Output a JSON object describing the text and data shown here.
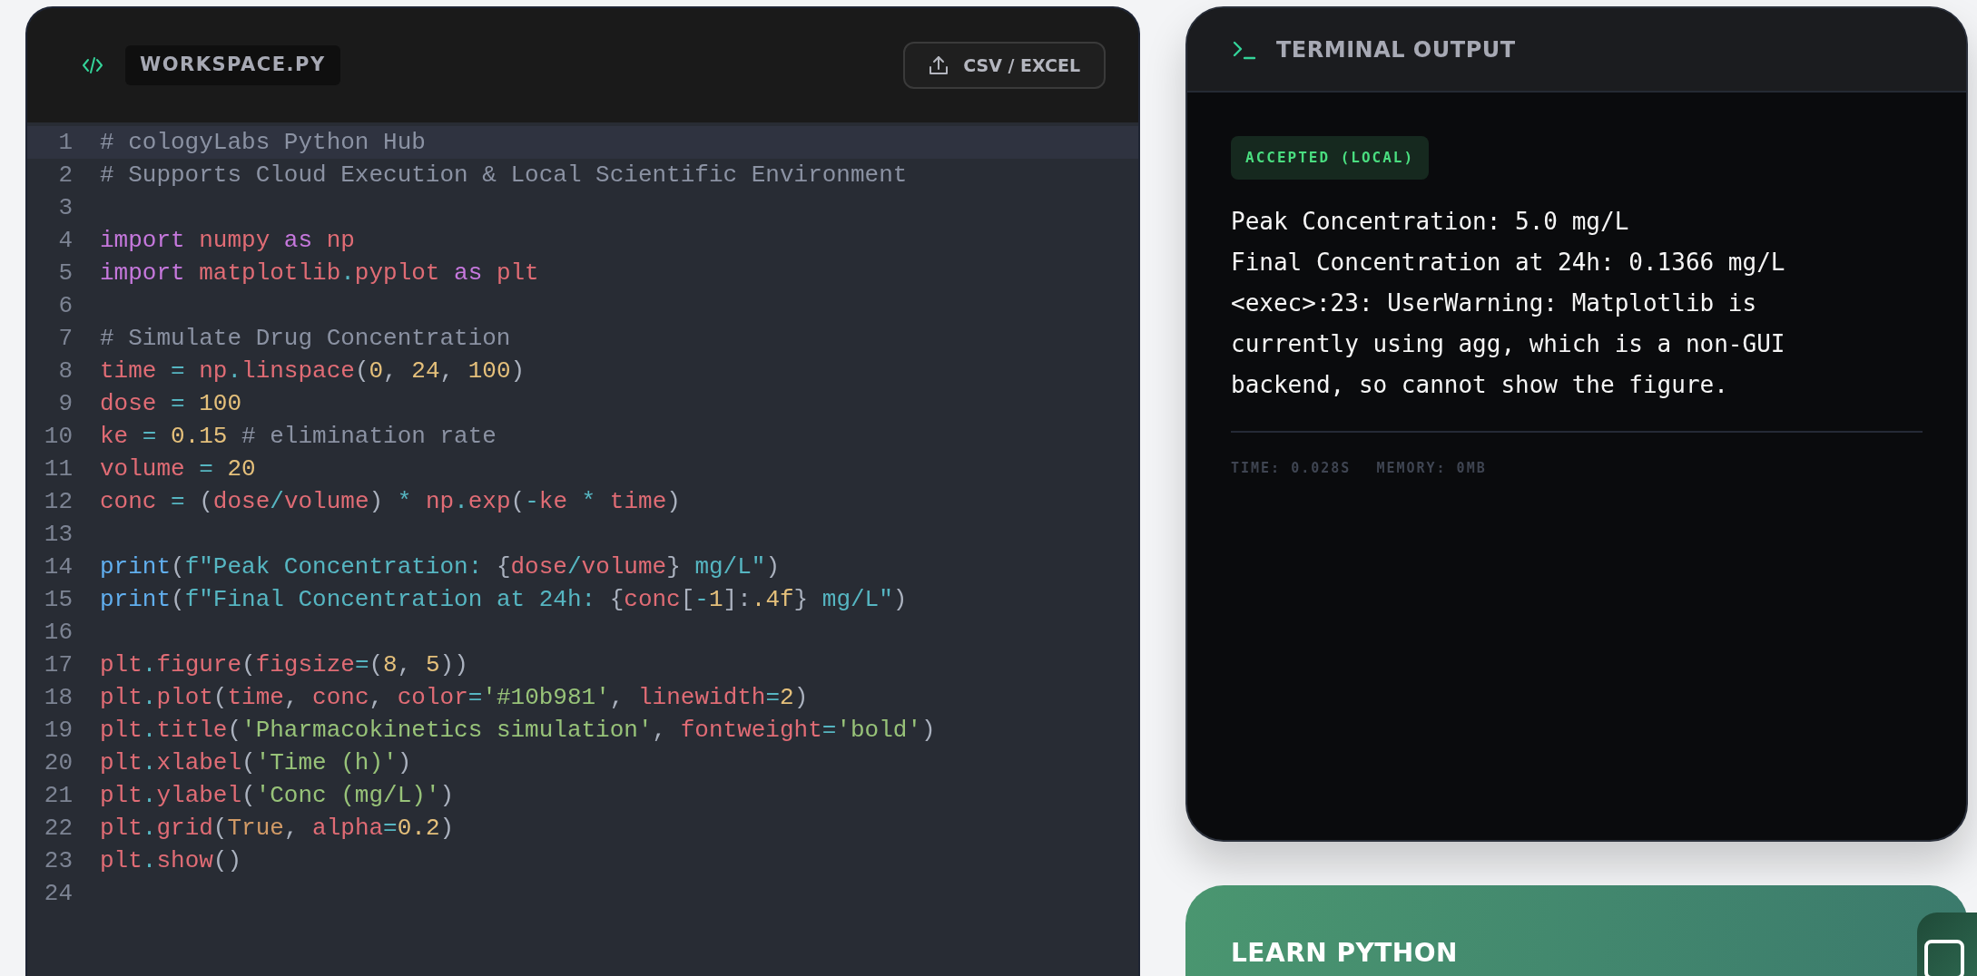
{
  "editor": {
    "filename": "WORKSPACE.PY",
    "export_button": "CSV / EXCEL",
    "lines": [
      {
        "number": "1",
        "active": true,
        "tokens": [
          {
            "kind": "comment",
            "text": "# cologyLabs Python Hub"
          }
        ]
      },
      {
        "number": "2",
        "active": false,
        "tokens": [
          {
            "kind": "comment",
            "text": "# Supports Cloud Execution & Local Scientific Environment"
          }
        ]
      },
      {
        "number": "3",
        "active": false
      },
      {
        "number": "4",
        "active": false,
        "tokens": [
          {
            "kind": "keyword",
            "text": "import "
          },
          {
            "kind": "name",
            "text": "numpy "
          },
          {
            "kind": "keyword",
            "text": "as "
          },
          {
            "kind": "name",
            "text": "np"
          }
        ]
      },
      {
        "number": "5",
        "active": false,
        "tokens": [
          {
            "kind": "keyword",
            "text": "import "
          },
          {
            "kind": "name",
            "text": "matplotlib"
          },
          {
            "kind": "operator",
            "text": "."
          },
          {
            "kind": "name",
            "text": "pyplot "
          },
          {
            "kind": "keyword",
            "text": "as "
          },
          {
            "kind": "name",
            "text": "plt"
          }
        ]
      },
      {
        "number": "6",
        "active": false
      },
      {
        "number": "7",
        "active": false,
        "tokens": [
          {
            "kind": "comment",
            "text": "# Simulate Drug Concentration"
          }
        ]
      },
      {
        "number": "8",
        "active": false,
        "tokens": [
          {
            "kind": "name",
            "text": "time "
          },
          {
            "kind": "operator",
            "text": "= "
          },
          {
            "kind": "name",
            "text": "np"
          },
          {
            "kind": "operator",
            "text": "."
          },
          {
            "kind": "name",
            "text": "linspace"
          },
          {
            "kind": "punct",
            "text": "("
          },
          {
            "kind": "number",
            "text": "0"
          },
          {
            "kind": "punct",
            "text": ", "
          },
          {
            "kind": "number",
            "text": "24"
          },
          {
            "kind": "punct",
            "text": ", "
          },
          {
            "kind": "number",
            "text": "100"
          },
          {
            "kind": "punct",
            "text": ")"
          }
        ]
      },
      {
        "number": "9",
        "active": false,
        "tokens": [
          {
            "kind": "name",
            "text": "dose "
          },
          {
            "kind": "operator",
            "text": "= "
          },
          {
            "kind": "number",
            "text": "100"
          }
        ]
      },
      {
        "number": "10",
        "active": false,
        "tokens": [
          {
            "kind": "name",
            "text": "ke "
          },
          {
            "kind": "operator",
            "text": "= "
          },
          {
            "kind": "number",
            "text": "0.15 "
          },
          {
            "kind": "comment",
            "text": "# elimination rate"
          }
        ]
      },
      {
        "number": "11",
        "active": false,
        "tokens": [
          {
            "kind": "name",
            "text": "volume "
          },
          {
            "kind": "operator",
            "text": "= "
          },
          {
            "kind": "number",
            "text": "20"
          }
        ]
      },
      {
        "number": "12",
        "active": false,
        "tokens": [
          {
            "kind": "name",
            "text": "conc "
          },
          {
            "kind": "operator",
            "text": "= "
          },
          {
            "kind": "punct",
            "text": "("
          },
          {
            "kind": "name",
            "text": "dose"
          },
          {
            "kind": "operator",
            "text": "/"
          },
          {
            "kind": "name",
            "text": "volume"
          },
          {
            "kind": "punct",
            "text": ") "
          },
          {
            "kind": "operator",
            "text": "* "
          },
          {
            "kind": "name",
            "text": "np"
          },
          {
            "kind": "operator",
            "text": "."
          },
          {
            "kind": "name",
            "text": "exp"
          },
          {
            "kind": "punct",
            "text": "("
          },
          {
            "kind": "operator",
            "text": "-"
          },
          {
            "kind": "name",
            "text": "ke "
          },
          {
            "kind": "operator",
            "text": "* "
          },
          {
            "kind": "name",
            "text": "time"
          },
          {
            "kind": "punct",
            "text": ")"
          }
        ]
      },
      {
        "number": "13",
        "active": false
      },
      {
        "number": "14",
        "active": false,
        "tokens": [
          {
            "kind": "function",
            "text": "print"
          },
          {
            "kind": "punct",
            "text": "("
          },
          {
            "kind": "fstring",
            "text": "f\"Peak Concentration: "
          },
          {
            "kind": "punct",
            "text": "{"
          },
          {
            "kind": "name",
            "text": "dose"
          },
          {
            "kind": "operator",
            "text": "/"
          },
          {
            "kind": "name",
            "text": "volume"
          },
          {
            "kind": "punct",
            "text": "} "
          },
          {
            "kind": "fstring",
            "text": "mg/L\""
          },
          {
            "kind": "punct",
            "text": ")"
          }
        ]
      },
      {
        "number": "15",
        "active": false,
        "tokens": [
          {
            "kind": "function",
            "text": "print"
          },
          {
            "kind": "punct",
            "text": "("
          },
          {
            "kind": "fstring",
            "text": "f\"Final Concentration at 24h: "
          },
          {
            "kind": "punct",
            "text": "{"
          },
          {
            "kind": "name",
            "text": "conc"
          },
          {
            "kind": "punct",
            "text": "["
          },
          {
            "kind": "operator",
            "text": "-"
          },
          {
            "kind": "number",
            "text": "1"
          },
          {
            "kind": "punct",
            "text": "]:"
          },
          {
            "kind": "number",
            "text": ".4f"
          },
          {
            "kind": "punct",
            "text": "} "
          },
          {
            "kind": "fstring",
            "text": "mg/L\""
          },
          {
            "kind": "punct",
            "text": ")"
          }
        ]
      },
      {
        "number": "16",
        "active": false
      },
      {
        "number": "17",
        "active": false,
        "tokens": [
          {
            "kind": "name",
            "text": "plt"
          },
          {
            "kind": "operator",
            "text": "."
          },
          {
            "kind": "name",
            "text": "figure"
          },
          {
            "kind": "punct",
            "text": "("
          },
          {
            "kind": "name",
            "text": "figsize"
          },
          {
            "kind": "operator",
            "text": "="
          },
          {
            "kind": "punct",
            "text": "("
          },
          {
            "kind": "number",
            "text": "8"
          },
          {
            "kind": "punct",
            "text": ", "
          },
          {
            "kind": "number",
            "text": "5"
          },
          {
            "kind": "punct",
            "text": "))"
          }
        ]
      },
      {
        "number": "18",
        "active": false,
        "tokens": [
          {
            "kind": "name",
            "text": "plt"
          },
          {
            "kind": "operator",
            "text": "."
          },
          {
            "kind": "name",
            "text": "plot"
          },
          {
            "kind": "punct",
            "text": "("
          },
          {
            "kind": "name",
            "text": "time"
          },
          {
            "kind": "punct",
            "text": ", "
          },
          {
            "kind": "name",
            "text": "conc"
          },
          {
            "kind": "punct",
            "text": ", "
          },
          {
            "kind": "name",
            "text": "color"
          },
          {
            "kind": "operator",
            "text": "="
          },
          {
            "kind": "string",
            "text": "'#10b981'"
          },
          {
            "kind": "punct",
            "text": ", "
          },
          {
            "kind": "name",
            "text": "linewidth"
          },
          {
            "kind": "operator",
            "text": "="
          },
          {
            "kind": "number",
            "text": "2"
          },
          {
            "kind": "punct",
            "text": ")"
          }
        ]
      },
      {
        "number": "19",
        "active": false,
        "tokens": [
          {
            "kind": "name",
            "text": "plt"
          },
          {
            "kind": "operator",
            "text": "."
          },
          {
            "kind": "name",
            "text": "title"
          },
          {
            "kind": "punct",
            "text": "("
          },
          {
            "kind": "string",
            "text": "'Pharmacokinetics simulation'"
          },
          {
            "kind": "punct",
            "text": ", "
          },
          {
            "kind": "name",
            "text": "fontweight"
          },
          {
            "kind": "operator",
            "text": "="
          },
          {
            "kind": "string",
            "text": "'bold'"
          },
          {
            "kind": "punct",
            "text": ")"
          }
        ]
      },
      {
        "number": "20",
        "active": false,
        "tokens": [
          {
            "kind": "name",
            "text": "plt"
          },
          {
            "kind": "operator",
            "text": "."
          },
          {
            "kind": "name",
            "text": "xlabel"
          },
          {
            "kind": "punct",
            "text": "("
          },
          {
            "kind": "string",
            "text": "'Time (h)'"
          },
          {
            "kind": "punct",
            "text": ")"
          }
        ]
      },
      {
        "number": "21",
        "active": false,
        "tokens": [
          {
            "kind": "name",
            "text": "plt"
          },
          {
            "kind": "operator",
            "text": "."
          },
          {
            "kind": "name",
            "text": "ylabel"
          },
          {
            "kind": "punct",
            "text": "("
          },
          {
            "kind": "string",
            "text": "'Conc (mg/L)'"
          },
          {
            "kind": "punct",
            "text": ")"
          }
        ]
      },
      {
        "number": "22",
        "active": false,
        "tokens": [
          {
            "kind": "name",
            "text": "plt"
          },
          {
            "kind": "operator",
            "text": "."
          },
          {
            "kind": "name",
            "text": "grid"
          },
          {
            "kind": "punct",
            "text": "("
          },
          {
            "kind": "boolean",
            "text": "True"
          },
          {
            "kind": "punct",
            "text": ", "
          },
          {
            "kind": "name",
            "text": "alpha"
          },
          {
            "kind": "operator",
            "text": "="
          },
          {
            "kind": "number",
            "text": "0.2"
          },
          {
            "kind": "punct",
            "text": ")"
          }
        ]
      },
      {
        "number": "23",
        "active": false,
        "tokens": [
          {
            "kind": "name",
            "text": "plt"
          },
          {
            "kind": "operator",
            "text": "."
          },
          {
            "kind": "name",
            "text": "show"
          },
          {
            "kind": "punct",
            "text": "()"
          }
        ]
      },
      {
        "number": "24",
        "active": false
      }
    ]
  },
  "terminal": {
    "title": "TERMINAL OUTPUT",
    "status": {
      "text": "ACCEPTED (LOCAL)",
      "kind": "success"
    },
    "output": [
      "Peak Concentration: 5.0 mg/L",
      "Final Concentration at 24h: 0.1366 mg/L",
      "<exec>:23: UserWarning: Matplotlib is currently using agg, which is a non-GUI backend, so cannot show the figure."
    ],
    "stats": [
      "TIME: 0.028S",
      "MEMORY: 0MB"
    ]
  },
  "learn_card": {
    "title": "LEARN PYTHON"
  }
}
